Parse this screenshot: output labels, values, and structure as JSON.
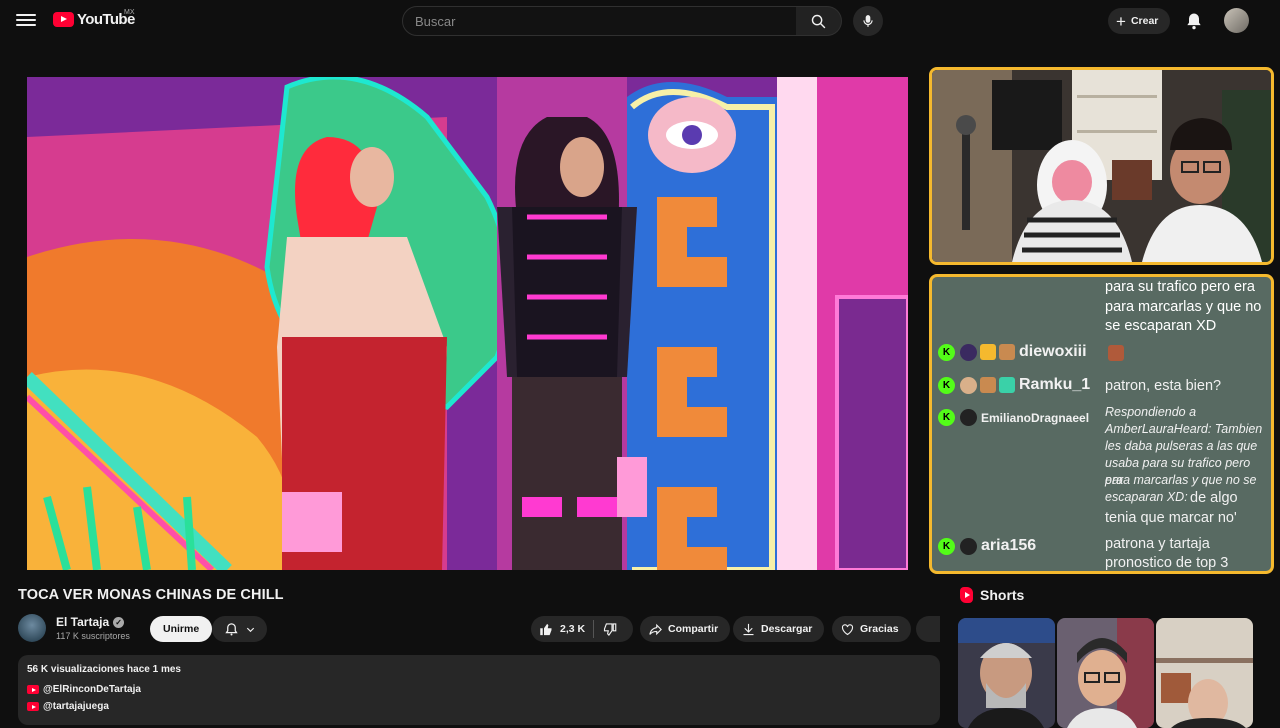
{
  "header": {
    "logo_text": "YouTube",
    "country_code": "MX",
    "search_placeholder": "Buscar",
    "create_label": "Crear",
    "icons": [
      "menu-icon",
      "search-icon",
      "mic-icon",
      "plus-icon",
      "bell-icon"
    ]
  },
  "video": {
    "title": "TOCA VER MONAS CHINAS DE CHILL",
    "channel_name": "El Tartaja",
    "subscribers": "117 K suscriptores",
    "join_label": "Unirme",
    "likes": "2,3 K",
    "share_label": "Compartir",
    "download_label": "Descargar",
    "thanks_label": "Gracias",
    "stats": "56 K visualizaciones  hace 1 mes",
    "links": [
      "@ElRinconDeTartaja",
      "@tartajajuega"
    ]
  },
  "chat": {
    "prev_text": [
      "para su trafico pero era",
      "para marcarlas y que no",
      "se escaparan XD"
    ],
    "messages": [
      {
        "user": "diewoxiii",
        "text": ""
      },
      {
        "user": "Ramku_1",
        "text": "patron, esta bien?"
      },
      {
        "user": "EmilianoDragnaeel",
        "reply": [
          "Respondiendo a",
          "AmberLauraHeard: Tambien",
          "les daba pulseras a las que",
          "usaba para su trafico pero era",
          "para marcarlas y que no se",
          "escaparan XD:"
        ],
        "text_inline": "de algo",
        "text": "tenia que marcar no'"
      },
      {
        "user": "aria156",
        "text": [
          "patrona y tartaja",
          "pronostico de top 3"
        ]
      }
    ]
  },
  "shorts": {
    "heading": "Shorts"
  },
  "colors": {
    "accent": "#ff0033",
    "frame": "#f5b92e",
    "kick_green": "#53fc18"
  }
}
